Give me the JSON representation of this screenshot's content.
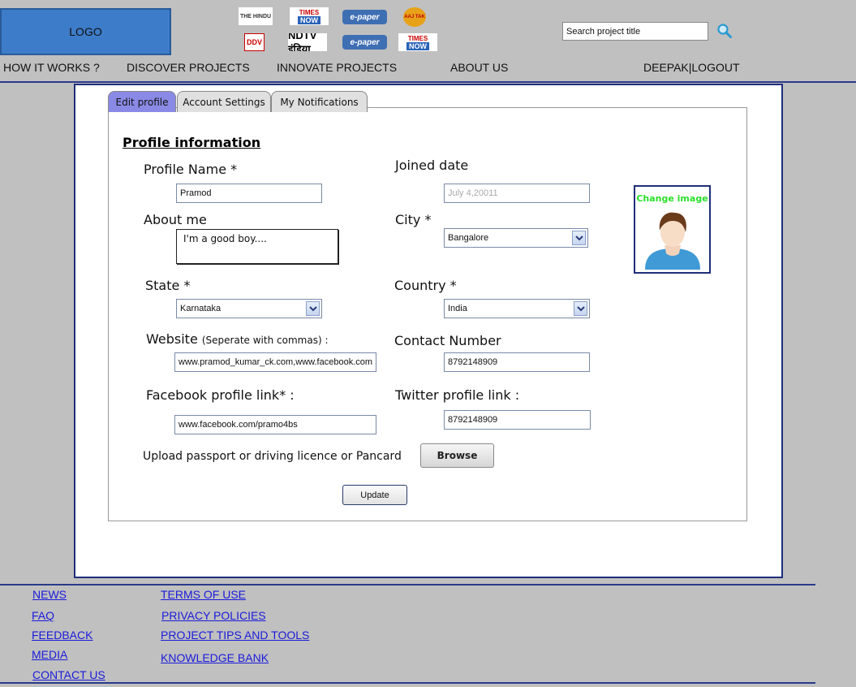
{
  "header": {
    "logo_text": "LOGO",
    "search": {
      "placeholder": "Search project title"
    },
    "media_logos": {
      "l1": "THE HINDU",
      "l2_a": "TIMES",
      "l2_b": "NOW",
      "l3": "e-paper",
      "l4": "AAJ TAK",
      "l5": "DDV",
      "l6": "NDTV इंडिया",
      "l7": "e-paper",
      "l8_a": "TIMES",
      "l8_b": "NOW"
    }
  },
  "nav": {
    "how_it_works": "HOW IT WORKS ?",
    "discover": "DISCOVER PROJECTS",
    "innovate": "INNOVATE PROJECTS",
    "about": "ABOUT US",
    "user": "DEEPAK|LOGOUT"
  },
  "tabs": {
    "edit_profile": "Edit profile",
    "account_settings": "Account Settings",
    "notifications": "My Notifications"
  },
  "form": {
    "section_title": "Profile information",
    "profile_name": {
      "label": "Profile Name *",
      "value": "Pramod"
    },
    "joined_date": {
      "label": "Joined date",
      "value": "July 4,20011"
    },
    "about_me": {
      "label": "About me",
      "value": "I'm a good boy...."
    },
    "city": {
      "label": "City *",
      "value": "Bangalore"
    },
    "state": {
      "label": "State *",
      "value": "Karnataka"
    },
    "country": {
      "label": "Country *",
      "value": "India"
    },
    "website": {
      "label": "Website",
      "hint": "(Seperate with commas) :",
      "value": "www.pramod_kumar_ck.com,www.facebook.com"
    },
    "contact_number": {
      "label": "Contact Number",
      "value": "8792148909"
    },
    "facebook": {
      "label": "Facebook profile link* :",
      "value": "www.facebook.com/pramo4bs"
    },
    "twitter": {
      "label": "Twitter profile link :",
      "value": "8792148909"
    },
    "upload": {
      "label": "Upload passport or driving licence or Pancard",
      "button": "Browse"
    },
    "update_button": "Update",
    "change_image": "Change image"
  },
  "footer": {
    "col1": [
      "NEWS",
      "FAQ",
      "FEEDBACK",
      "MEDIA",
      "CONTACT US"
    ],
    "col2": [
      "TERMS OF USE",
      "PRIVACY POLICIES",
      "PROJECT TIPS AND TOOLS",
      "KNOWLEDGE BANK"
    ]
  },
  "colors": {
    "accent_blue": "#1f2e7a",
    "logo_blue": "#3d7cc9",
    "active_tab": "#8a8ae6",
    "link": "#1a1adb",
    "change_image_green": "#2ae02a"
  }
}
